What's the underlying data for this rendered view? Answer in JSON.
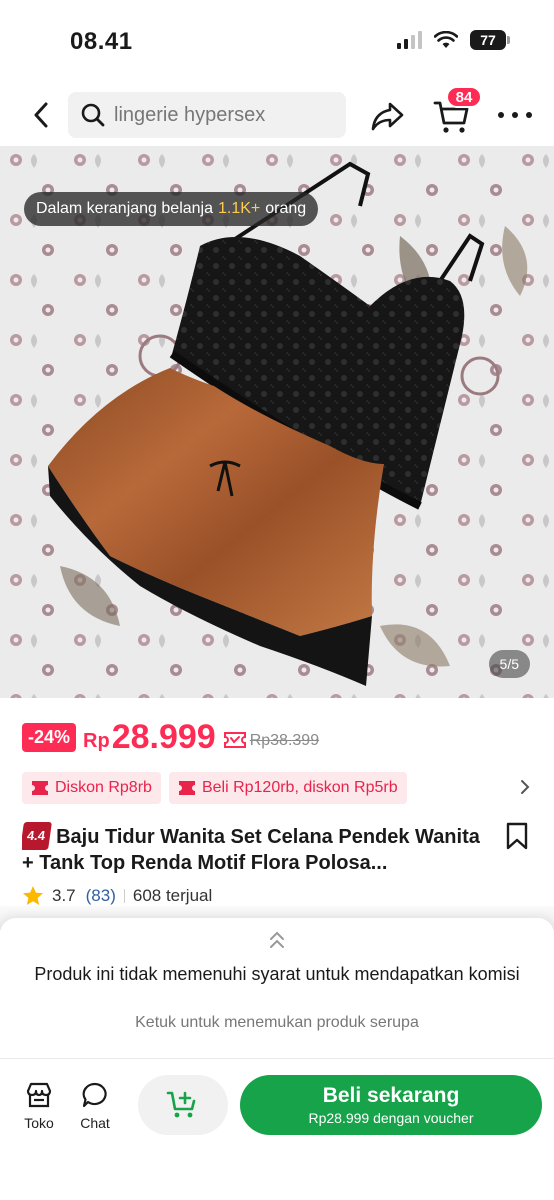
{
  "status_bar": {
    "time": "08.41",
    "battery": "77"
  },
  "header": {
    "search_value": "lingerie hypersex",
    "cart_count": "84"
  },
  "product_image": {
    "cart_notice_prefix": "Dalam keranjang belanja",
    "cart_notice_highlight": "1.1K+",
    "cart_notice_suffix": "orang",
    "image_counter": "5/5"
  },
  "price": {
    "discount": "-24%",
    "currency": "Rp",
    "value": "28.999",
    "original": "Rp38.399"
  },
  "promos": [
    {
      "label": "Diskon Rp8rb"
    },
    {
      "label": "Beli Rp120rb, diskon Rp5rb"
    }
  ],
  "product": {
    "badge": "4.4",
    "title": "Baju Tidur Wanita Set Celana Pendek Wanita + Tank Top Renda Motif Flora Polosa...",
    "rating": "3.7",
    "review_count": "(83)",
    "sold": "608 terjual"
  },
  "sheet": {
    "message": "Produk ini tidak memenuhi syarat untuk mendapatkan komisi",
    "sub": "Ketuk untuk menemukan produk serupa"
  },
  "bottom_bar": {
    "shop_label": "Toko",
    "chat_label": "Chat",
    "buy_label": "Beli sekarang",
    "buy_sub": "Rp28.999 dengan voucher"
  },
  "colors": {
    "accent_red": "#fe2c55",
    "buy_green": "#16a34a",
    "badge_dark_red": "#b8182e",
    "chip_background": "#fde8ec"
  }
}
